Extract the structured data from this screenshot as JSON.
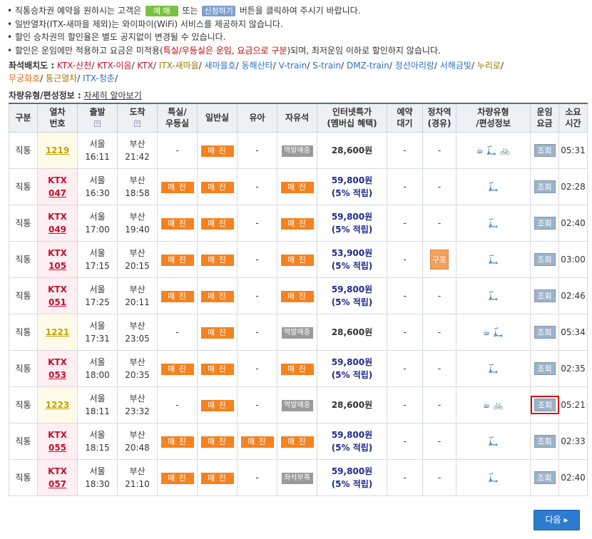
{
  "notices": [
    {
      "pre": "직통승차권 예약을 원하시는 고객은",
      "btn1": "예 매",
      "mid": "또는",
      "btn2": "신청하기",
      "post": "버튼을 클릭하여 주시기 바랍니다."
    },
    {
      "text": "일반열차(ITX-새마을 제외)는 와이파이(WiFi) 서비스를 제공하지 않습니다."
    },
    {
      "text": "할인 승차권의 할인율은 별도 공지없이 변경될 수 있습니다."
    },
    {
      "pre": "할인은 운임에만 적용하고 요금은 미적용(",
      "red": "특실/우등실은 운임, 요금으로 구분",
      "post": ")되며, 최저운임 이하로 할인하지 않습니다."
    }
  ],
  "seat_map": {
    "label": "좌석배치도 :",
    "line1": [
      {
        "t": "KTX-산천",
        "c": "red"
      },
      {
        "t": "KTX-이음",
        "c": "red"
      },
      {
        "t": "KTX",
        "c": "red"
      },
      {
        "t": "ITX-새마을",
        "c": "olive"
      },
      {
        "t": "새마을호",
        "c": "blue"
      },
      {
        "t": "동해산타",
        "c": "blue"
      },
      {
        "t": "V-train",
        "c": "blue"
      },
      {
        "t": "S-train",
        "c": "blue"
      },
      {
        "t": "DMZ-train",
        "c": "blue"
      },
      {
        "t": "정선아리랑",
        "c": "blue"
      },
      {
        "t": "서해금빛",
        "c": "blue"
      },
      {
        "t": "누리로",
        "c": "olive"
      }
    ],
    "line2": [
      {
        "t": "무궁화호",
        "c": "orange"
      },
      {
        "t": "통근열차",
        "c": "olive"
      },
      {
        "t": "ITX-청춘",
        "c": "blue"
      }
    ]
  },
  "vehicle_info": {
    "label": "차량유형/편성정보 :",
    "link": "자세히 알아보기"
  },
  "headers": {
    "type": "구분",
    "trainno1": "열차",
    "trainno2": "번호",
    "depart": "출발",
    "arrive": "도착",
    "first1": "특실/",
    "first2": "우등실",
    "general": "일반실",
    "infant": "유아",
    "free": "자유석",
    "internet1": "인터넷특가",
    "internet2": "(멤버십 혜택)",
    "wait1": "예약",
    "wait2": "대기",
    "stop1": "정차역",
    "stop2": "(경유)",
    "vehicle1": "차량유형",
    "vehicle2": "/편성정보",
    "fare1": "운임",
    "fare2": "요금",
    "time1": "소요",
    "time2": "시간"
  },
  "sort_glyph": "▽",
  "rows": [
    {
      "type": "직통",
      "ktx": false,
      "no": "1219",
      "dep_st": "서울",
      "dep_t": "16:11",
      "arr_st": "부산",
      "arr_t": "21:42",
      "first": "-",
      "general": "매 진",
      "infant": "-",
      "free": "역발매중",
      "free_style": "gray",
      "price": "28,600원",
      "price2": "",
      "wait": "-",
      "stop": "-",
      "icons": [
        "☕",
        "🛴",
        "🚲"
      ],
      "fare": "조회",
      "dur": "05:31"
    },
    {
      "type": "직통",
      "ktx": true,
      "ktx_label": "KTX",
      "no": "047",
      "dep_st": "서울",
      "dep_t": "16:30",
      "arr_st": "부산",
      "arr_t": "18:58",
      "first": "매 진",
      "general": "매 진",
      "infant": "-",
      "free": "매 진",
      "free_style": "orange",
      "price": "59,800원",
      "price2": "(5% 적립)",
      "wait": "-",
      "stop": "-",
      "icons": [
        "🛴"
      ],
      "fare": "조회",
      "dur": "02:28"
    },
    {
      "type": "직통",
      "ktx": true,
      "ktx_label": "KTX",
      "no": "049",
      "dep_st": "서울",
      "dep_t": "17:00",
      "arr_st": "부산",
      "arr_t": "19:40",
      "first": "매 진",
      "general": "매 진",
      "infant": "-",
      "free": "매 진",
      "free_style": "orange",
      "price": "59,800원",
      "price2": "(5% 적립)",
      "wait": "-",
      "stop": "-",
      "icons": [
        "🛴"
      ],
      "fare": "조회",
      "dur": "02:40"
    },
    {
      "type": "직통",
      "ktx": true,
      "ktx_label": "KTX",
      "no": "105",
      "dep_st": "서울",
      "dep_t": "17:15",
      "arr_st": "부산",
      "arr_t": "20:15",
      "first": "매 진",
      "general": "매 진",
      "infant": "-",
      "free": "매 진",
      "free_style": "orange",
      "price": "53,900원",
      "price2": "(5% 적립)",
      "wait": "-",
      "stop": "구포",
      "icons": [
        "🛴"
      ],
      "fare": "조회",
      "dur": "03:00"
    },
    {
      "type": "직통",
      "ktx": true,
      "ktx_label": "KTX",
      "no": "051",
      "dep_st": "서울",
      "dep_t": "17:25",
      "arr_st": "부산",
      "arr_t": "20:11",
      "first": "매 진",
      "general": "매 진",
      "infant": "-",
      "free": "매 진",
      "free_style": "orange",
      "price": "59,800원",
      "price2": "(5% 적립)",
      "wait": "-",
      "stop": "-",
      "icons": [
        "🛴"
      ],
      "fare": "조회",
      "dur": "02:46"
    },
    {
      "type": "직통",
      "ktx": false,
      "no": "1221",
      "dep_st": "서울",
      "dep_t": "17:31",
      "arr_st": "부산",
      "arr_t": "23:05",
      "first": "-",
      "general": "매 진",
      "infant": "-",
      "free": "역발매중",
      "free_style": "gray",
      "price": "28,600원",
      "price2": "",
      "wait": "-",
      "stop": "-",
      "icons": [
        "☕",
        "🛴"
      ],
      "fare": "조회",
      "dur": "05:34"
    },
    {
      "type": "직통",
      "ktx": true,
      "ktx_label": "KTX",
      "no": "053",
      "dep_st": "서울",
      "dep_t": "18:00",
      "arr_st": "부산",
      "arr_t": "20:35",
      "first": "매 진",
      "general": "매 진",
      "infant": "-",
      "free": "매 진",
      "free_style": "orange",
      "price": "59,800원",
      "price2": "(5% 적립)",
      "wait": "-",
      "stop": "-",
      "icons": [
        "🛴"
      ],
      "fare": "조회",
      "dur": "02:35"
    },
    {
      "type": "직통",
      "ktx": false,
      "no": "1223",
      "dep_st": "서울",
      "dep_t": "18:11",
      "arr_st": "부산",
      "arr_t": "23:32",
      "first": "-",
      "general": "매 진",
      "infant": "-",
      "free": "역발매중",
      "free_style": "gray",
      "price": "28,600원",
      "price2": "",
      "wait": "-",
      "stop": "-",
      "icons": [
        "☕",
        "🚲"
      ],
      "fare": "조회",
      "dur": "05:21",
      "highlight": true
    },
    {
      "type": "직통",
      "ktx": true,
      "ktx_label": "KTX",
      "no": "055",
      "dep_st": "서울",
      "dep_t": "18:15",
      "arr_st": "부산",
      "arr_t": "20:48",
      "first": "매 진",
      "general": "매 진",
      "infant": "매 진",
      "free": "매 진",
      "free_style": "orange",
      "price": "59,800원",
      "price2": "(5% 적립)",
      "wait": "-",
      "stop": "-",
      "icons": [
        "🛴"
      ],
      "fare": "조회",
      "dur": "02:33"
    },
    {
      "type": "직통",
      "ktx": true,
      "ktx_label": "KTX",
      "no": "057",
      "dep_st": "서울",
      "dep_t": "18:30",
      "arr_st": "부산",
      "arr_t": "21:10",
      "first": "매 진",
      "general": "매 진",
      "infant": "-",
      "free": "좌석부족",
      "free_style": "gray",
      "price": "59,800원",
      "price2": "(5% 적립)",
      "wait": "-",
      "stop": "-",
      "icons": [
        "🛴"
      ],
      "fare": "조회",
      "dur": "02:40"
    }
  ],
  "next_button": {
    "label": "다음",
    "arrow": "▸"
  },
  "colors": {
    "header_border": "#5a6b86",
    "orange": "#f58220",
    "gray": "#9a9a9a",
    "ktx_red": "#c0102b",
    "next_blue": "#2e7cd0"
  }
}
